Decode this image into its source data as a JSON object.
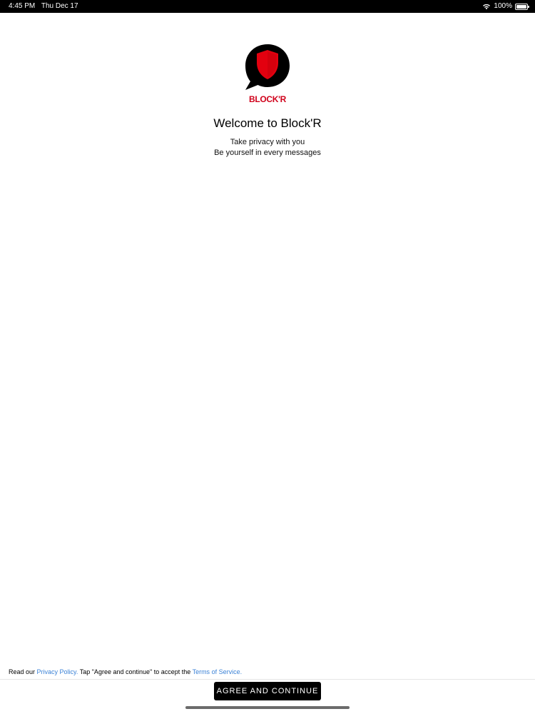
{
  "status_bar": {
    "time": "4:45 PM",
    "date": "Thu Dec 17",
    "battery": "100%"
  },
  "logo": {
    "text": "BLOCK'R",
    "colors": {
      "bubble": "#000000",
      "shield": "#e3000f",
      "text": "#d0021b"
    }
  },
  "welcome": {
    "title": "Welcome to Block'R",
    "tagline_1": "Take privacy with you",
    "tagline_2": "Be yourself in every messages"
  },
  "footer": {
    "legal_prefix": "Read our ",
    "privacy_link": "Privacy Policy.",
    "legal_middle": " Tap \"Agree and continue\" to accept the ",
    "terms_link": "Terms of Service.",
    "agree_button": "AGREE AND CONTINUE"
  },
  "colors": {
    "link": "#3b82d6",
    "button_bg": "#000000",
    "button_text": "#ffffff"
  }
}
